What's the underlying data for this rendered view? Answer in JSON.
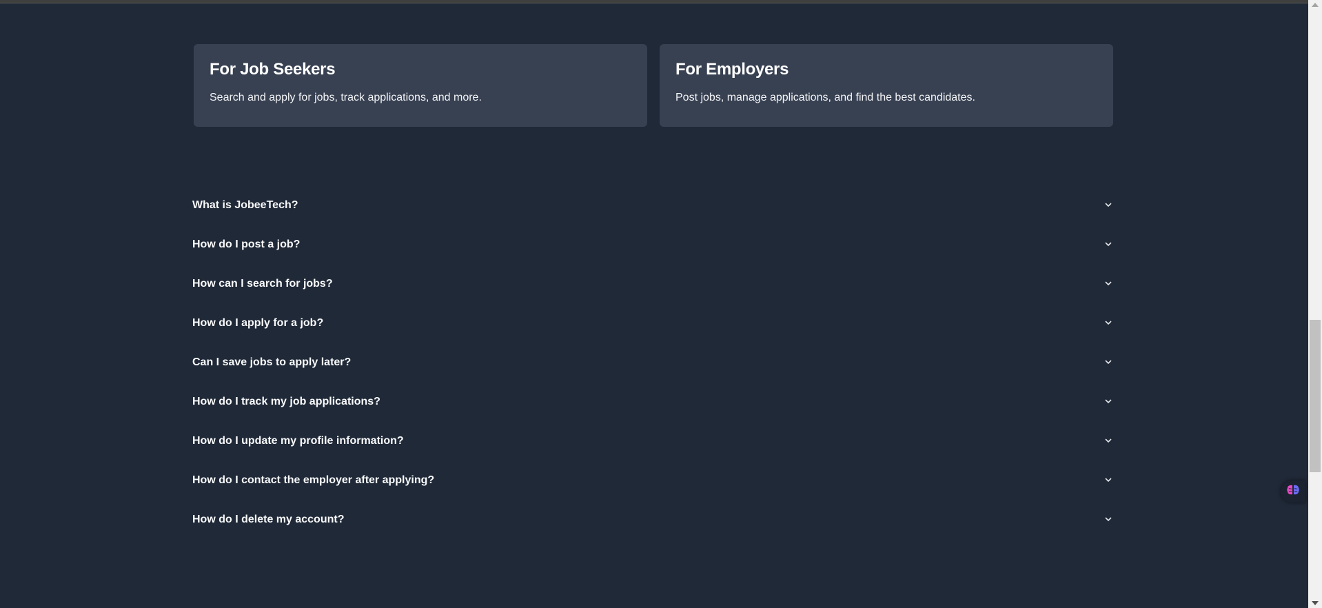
{
  "cards": [
    {
      "title": "For Job Seekers",
      "description": "Search and apply for jobs, track applications, and more."
    },
    {
      "title": "For Employers",
      "description": "Post jobs, manage applications, and find the best candidates."
    }
  ],
  "faq": [
    {
      "question": "What is JobeeTech?"
    },
    {
      "question": "How do I post a job?"
    },
    {
      "question": "How can I search for jobs?"
    },
    {
      "question": "How do I apply for a job?"
    },
    {
      "question": "Can I save jobs to apply later?"
    },
    {
      "question": "How do I track my job applications?"
    },
    {
      "question": "How do I update my profile information?"
    },
    {
      "question": "How do I contact the employer after applying?"
    },
    {
      "question": "How do I delete my account?"
    }
  ],
  "icons": {
    "faq_toggle": "chevron-down-icon",
    "floating_widget": "brain-icon"
  },
  "colors": {
    "background": "#202938",
    "card_background": "#384152",
    "text": "#ffffff",
    "widget_accent_pink": "#e04cc0",
    "widget_accent_blue": "#6b6cf5"
  }
}
